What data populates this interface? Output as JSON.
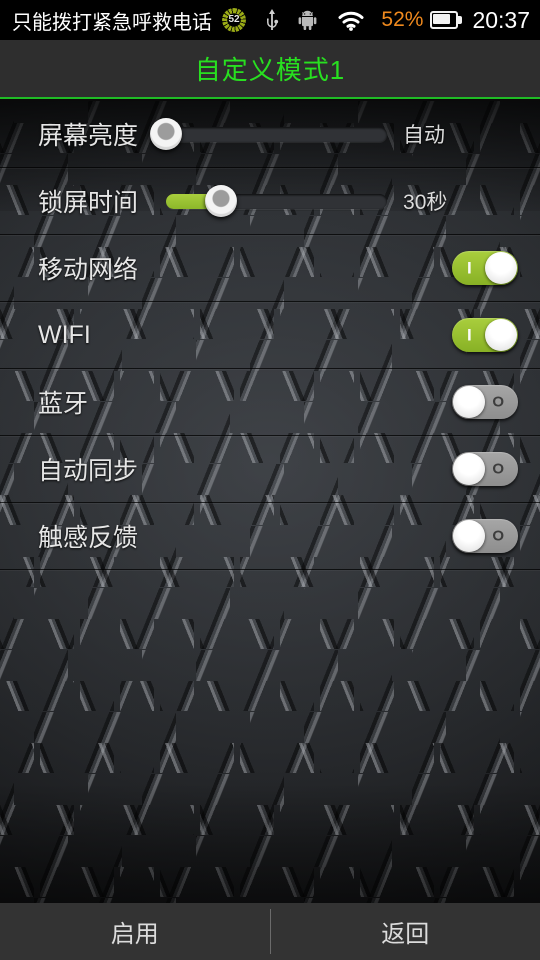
{
  "statusbar": {
    "carrier_text": "只能拨打紧急呼救电话",
    "badge_icon": "progress-badge-icon",
    "badge_value": "52",
    "usb_icon": "usb-icon",
    "android_icon": "android-robot-icon",
    "wifi_icon": "wifi-icon",
    "battery_percent": "52%",
    "battery_icon": "battery-icon",
    "clock": "20:37"
  },
  "header": {
    "title": "自定义模式1",
    "accent_color": "#28e020",
    "divider_color": "#1fbb25"
  },
  "settings": {
    "rows": [
      {
        "label": "屏幕亮度",
        "type": "slider",
        "value_text": "自动",
        "percent": 0
      },
      {
        "label": "锁屏时间",
        "type": "slider",
        "value_text": "30秒",
        "percent": 16
      },
      {
        "label": "移动网络",
        "type": "toggle",
        "state": "on",
        "mark": "I"
      },
      {
        "label": "WIFI",
        "type": "toggle",
        "state": "on",
        "mark": "I"
      },
      {
        "label": "蓝牙",
        "type": "toggle",
        "state": "off",
        "mark": "O"
      },
      {
        "label": "自动同步",
        "type": "toggle",
        "state": "off",
        "mark": "O"
      },
      {
        "label": "触感反馈",
        "type": "toggle",
        "state": "off",
        "mark": "O"
      }
    ]
  },
  "bottombar": {
    "enable_label": "启用",
    "back_label": "返回"
  },
  "theme": {
    "toggle_on_color": "#a9ce3d",
    "toggle_off_color": "#a6a6a6",
    "battery_text_color": "#f08a1e",
    "plate_base_color": "#2b2d30"
  }
}
